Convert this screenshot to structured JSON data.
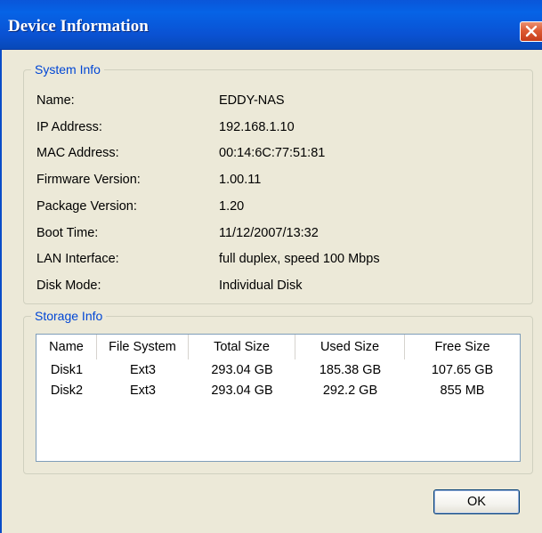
{
  "window": {
    "title": "Device Information"
  },
  "system_info": {
    "legend": "System Info",
    "rows": [
      {
        "label": "Name:",
        "value": "EDDY-NAS"
      },
      {
        "label": "IP Address:",
        "value": "192.168.1.10"
      },
      {
        "label": "MAC Address:",
        "value": "00:14:6C:77:51:81"
      },
      {
        "label": "Firmware Version:",
        "value": "1.00.11"
      },
      {
        "label": "Package Version:",
        "value": "1.20"
      },
      {
        "label": "Boot Time:",
        "value": "11/12/2007/13:32"
      },
      {
        "label": "LAN Interface:",
        "value": "full duplex, speed 100 Mbps"
      },
      {
        "label": "Disk Mode:",
        "value": "Individual Disk"
      }
    ]
  },
  "storage_info": {
    "legend": "Storage Info",
    "columns": [
      "Name",
      "File System",
      "Total Size",
      "Used Size",
      "Free Size"
    ],
    "rows": [
      [
        "Disk1",
        "Ext3",
        "293.04 GB",
        "185.38 GB",
        "107.65 GB"
      ],
      [
        "Disk2",
        "Ext3",
        "293.04 GB",
        "292.2 GB",
        "855 MB"
      ]
    ]
  },
  "buttons": {
    "ok_label": "OK"
  },
  "icons": {
    "close": "close-icon"
  },
  "colors": {
    "titlebar": "#0a56d9",
    "legend_text": "#0046d5",
    "close": "#dd5a33"
  }
}
